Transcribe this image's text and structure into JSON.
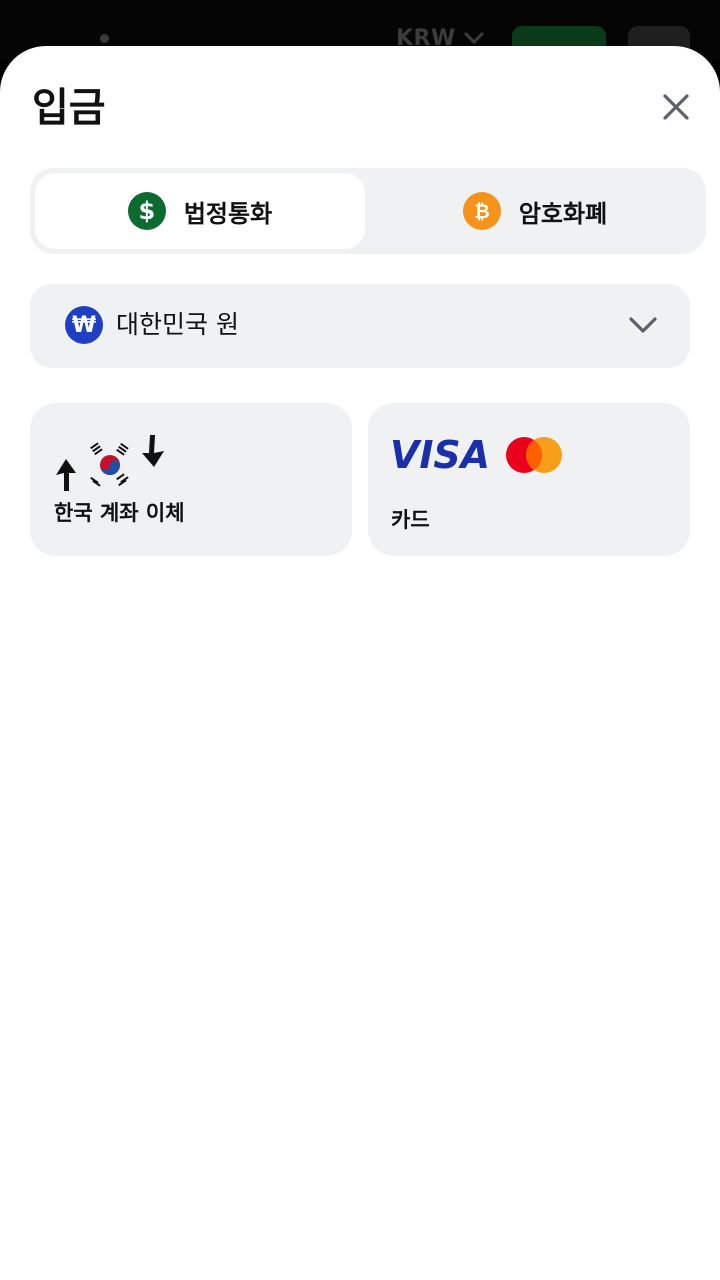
{
  "background": {
    "currency_code": "KRW"
  },
  "sheet": {
    "title": "입금",
    "tabs": [
      {
        "label": "법정통화",
        "icon": "dollar-coin-icon",
        "icon_color": "#0c6b2e",
        "active": true
      },
      {
        "label": "암호화폐",
        "icon": "bitcoin-icon",
        "icon_color": "#f7931a",
        "active": false
      }
    ],
    "currency_select": {
      "label": "대한민국 원",
      "icon": "won-icon",
      "icon_color": "#1f3fc4"
    },
    "methods": [
      {
        "label": "한국 계좌 이체",
        "icon": "korea-flag-transfer-icon"
      },
      {
        "label": "카드",
        "icons": [
          "visa-logo",
          "mastercard-logo"
        ],
        "visa_text": "VISA"
      }
    ]
  },
  "colors": {
    "surface": "#f0f1f3",
    "text": "#111111",
    "accent_green": "#0c6b2e",
    "bitcoin_orange": "#f7931a",
    "visa_blue": "#1a2fa8",
    "mc_red": "#eb001b",
    "mc_orange": "#f79e1b"
  }
}
